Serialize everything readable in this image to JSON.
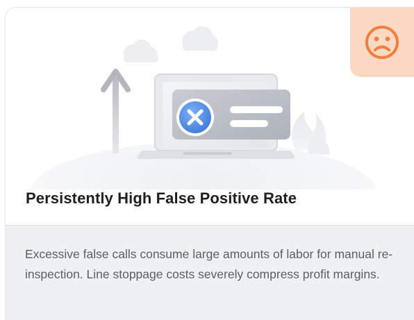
{
  "card": {
    "title": "Persistently High False Positive Rate",
    "description": "Excessive false calls consume large amounts of labor for manual re-inspection. Line stoppage costs severely compress profit margins.",
    "badge_icon": "sad-face-icon",
    "illustration_icons": [
      "error-x-icon",
      "up-arrow-icon",
      "cloud-icon",
      "laptop-icon",
      "message-card-icon"
    ]
  },
  "colors": {
    "badge_background": "#fdd8c2",
    "badge_icon": "#f07f3c",
    "title_text": "#1f1f1f",
    "description_text": "#5a5f66",
    "description_background": "#eef0f1",
    "error_icon": "#4a86e8"
  }
}
